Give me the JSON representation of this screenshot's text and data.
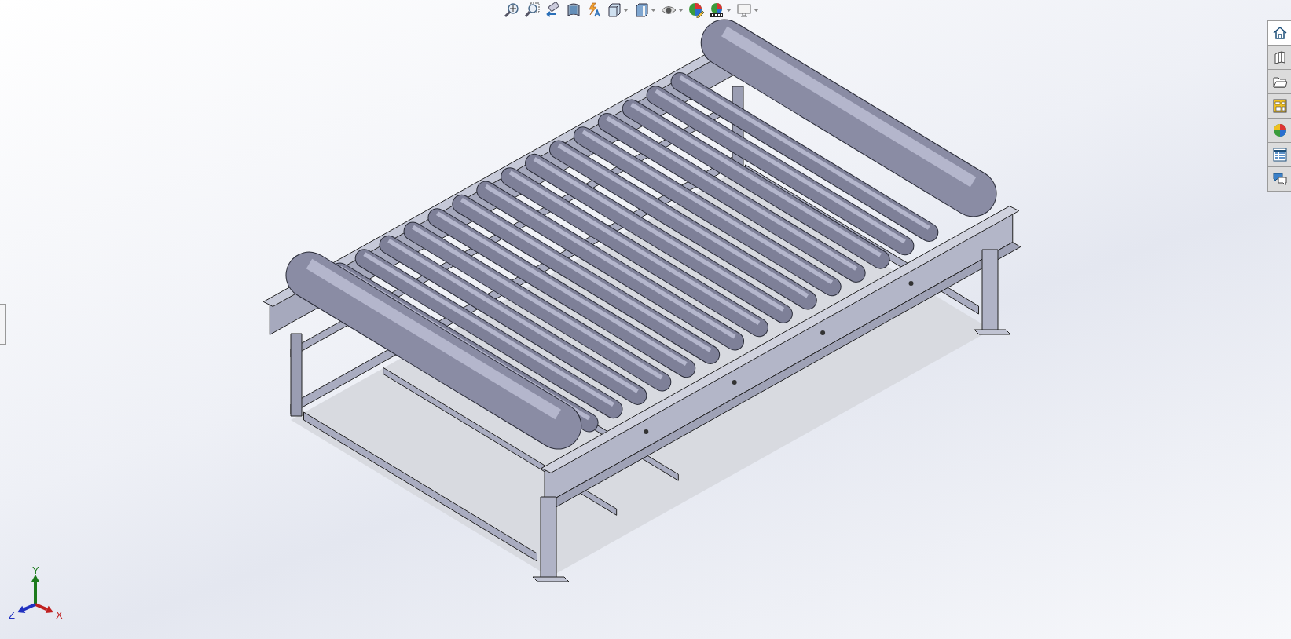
{
  "view_toolbar": {
    "buttons": [
      {
        "kind": "zoom-fit",
        "dropdown": false
      },
      {
        "kind": "zoom-area",
        "dropdown": false
      },
      {
        "kind": "previous-view",
        "dropdown": false
      },
      {
        "kind": "section-view",
        "dropdown": false
      },
      {
        "kind": "dynamic-annotation",
        "dropdown": false
      },
      {
        "kind": "view-orientation",
        "dropdown": true
      },
      {
        "kind": "display-style",
        "dropdown": true
      },
      {
        "kind": "hide-show",
        "dropdown": true
      },
      {
        "kind": "edit-appearance",
        "dropdown": false
      },
      {
        "kind": "apply-scene",
        "dropdown": true
      },
      {
        "kind": "view-settings",
        "dropdown": true
      }
    ]
  },
  "task_pane": {
    "tabs": [
      {
        "kind": "home",
        "selected": true
      },
      {
        "kind": "library",
        "selected": false
      },
      {
        "kind": "file-explorer",
        "selected": false
      },
      {
        "kind": "view-palette",
        "selected": false
      },
      {
        "kind": "appearances",
        "selected": false
      },
      {
        "kind": "custom-properties",
        "selected": false
      },
      {
        "kind": "forum",
        "selected": false
      }
    ]
  },
  "triad": {
    "x": "X",
    "y": "Y",
    "z": "Z"
  }
}
